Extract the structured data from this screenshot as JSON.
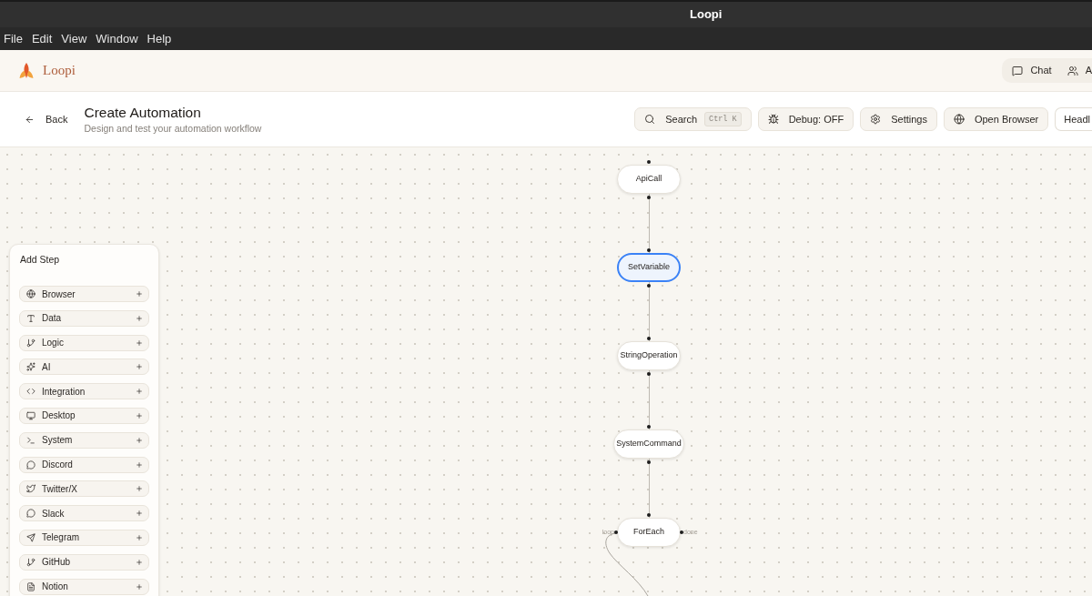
{
  "window": {
    "title": "Loopi"
  },
  "menu_bar": {
    "items": [
      "File",
      "Edit",
      "View",
      "Window",
      "Help"
    ]
  },
  "app_header": {
    "brand": "Loopi",
    "nav": [
      {
        "label": "Chat"
      },
      {
        "label": "A"
      }
    ]
  },
  "page_header": {
    "back": "Back",
    "title": "Create Automation",
    "subtitle": "Design and test your automation workflow",
    "actions": [
      {
        "kind": "search",
        "label": "Search",
        "shortcut": "Ctrl K"
      },
      {
        "kind": "button",
        "label": "Debug: OFF"
      },
      {
        "kind": "button",
        "label": "Settings"
      },
      {
        "kind": "button",
        "label": "Open Browser"
      },
      {
        "kind": "outline",
        "label": "Headl"
      }
    ]
  },
  "add_step_panel": {
    "title": "Add Step",
    "categories": [
      "Browser",
      "Data",
      "Logic",
      "AI",
      "Integration",
      "Desktop",
      "System",
      "Discord",
      "Twitter/X",
      "Slack",
      "Telegram",
      "GitHub",
      "Notion"
    ]
  },
  "workflow": {
    "nodes": [
      {
        "kind": "step",
        "label": "ApiCall",
        "selected": false
      },
      {
        "kind": "step",
        "label": "SetVariable",
        "selected": true
      },
      {
        "kind": "step",
        "label": "StringOperation",
        "selected": false
      },
      {
        "kind": "step",
        "label": "SystemCommand",
        "selected": false
      },
      {
        "kind": "loop",
        "label": "ForEach",
        "selected": false,
        "left_port": "loop",
        "right_port": "done"
      }
    ]
  }
}
